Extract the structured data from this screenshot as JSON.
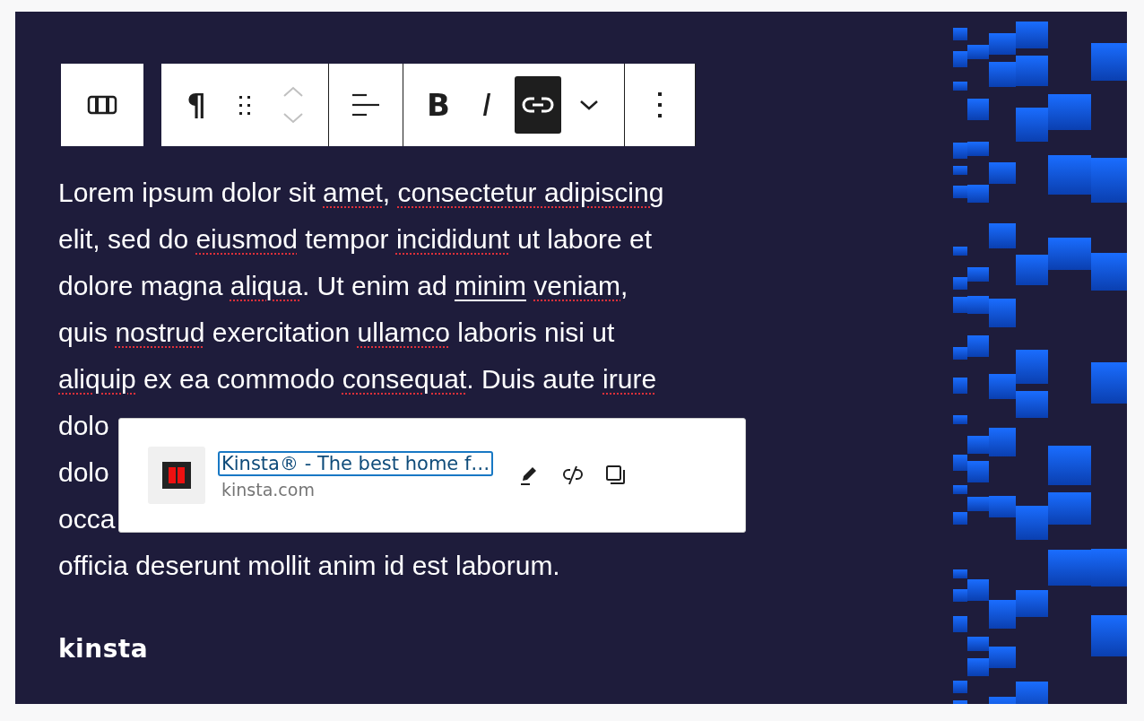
{
  "toolbar": [
    [
      {
        "kind": "block-switcher",
        "active": false
      }
    ],
    [
      {
        "kind": "symbol",
        "label": "¶",
        "active": false
      },
      {
        "kind": "drag",
        "active": false
      },
      {
        "kind": "mover",
        "active": false,
        "disabled": true
      }
    ],
    [
      {
        "kind": "align",
        "active": false
      }
    ],
    [
      {
        "kind": "symbol",
        "label": "B",
        "active": false
      },
      {
        "kind": "italic",
        "label": "I",
        "active": false
      },
      {
        "kind": "link",
        "active": true
      },
      {
        "kind": "caret",
        "active": false
      }
    ],
    [
      {
        "kind": "options",
        "active": false
      }
    ]
  ],
  "paragraph": [
    [
      {
        "kind": "plain",
        "text": "Lorem ipsum dolor sit "
      },
      {
        "kind": "misspelled",
        "text": "amet"
      },
      {
        "kind": "plain",
        "text": ", "
      },
      {
        "kind": "misspelled",
        "text": "consectetur adipiscing"
      }
    ],
    [
      {
        "kind": "plain",
        "text": "elit, sed do "
      },
      {
        "kind": "misspelled",
        "text": "eiusmod"
      },
      {
        "kind": "plain",
        "text": " tempor "
      },
      {
        "kind": "misspelled",
        "text": "incididunt"
      },
      {
        "kind": "plain",
        "text": " ut labore et"
      }
    ],
    [
      {
        "kind": "plain",
        "text": "dolore magna "
      },
      {
        "kind": "misspelled",
        "text": "aliqua"
      },
      {
        "kind": "plain",
        "text": ". Ut enim ad "
      },
      {
        "kind": "link",
        "text": "minim"
      },
      {
        "kind": "misspelled",
        "text": " veniam"
      },
      {
        "kind": "plain",
        "text": ","
      }
    ],
    [
      {
        "kind": "plain",
        "text": "quis "
      },
      {
        "kind": "misspelled",
        "text": "nostrud"
      },
      {
        "kind": "plain",
        "text": " exercitation "
      },
      {
        "kind": "misspelled",
        "text": "ullamco"
      },
      {
        "kind": "plain",
        "text": " laboris nisi ut"
      }
    ],
    [
      {
        "kind": "misspelled",
        "text": "aliquip"
      },
      {
        "kind": "plain",
        "text": " ex ea commodo "
      },
      {
        "kind": "misspelled",
        "text": "consequat"
      },
      {
        "kind": "plain",
        "text": ". Duis aute "
      },
      {
        "kind": "misspelled",
        "text": "irure"
      }
    ],
    [
      {
        "kind": "plain",
        "text": "dolo"
      }
    ],
    [
      {
        "kind": "plain",
        "text": "dolo"
      }
    ],
    [
      {
        "kind": "plain",
        "text": "occa"
      }
    ],
    [
      {
        "kind": "plain",
        "text": "officia deserunt mollit anim id est laborum."
      }
    ]
  ],
  "link_popover": {
    "title": "Kinsta® - The best home f…",
    "url": "kinsta.com",
    "focused": true
  },
  "logo": "kinsta"
}
